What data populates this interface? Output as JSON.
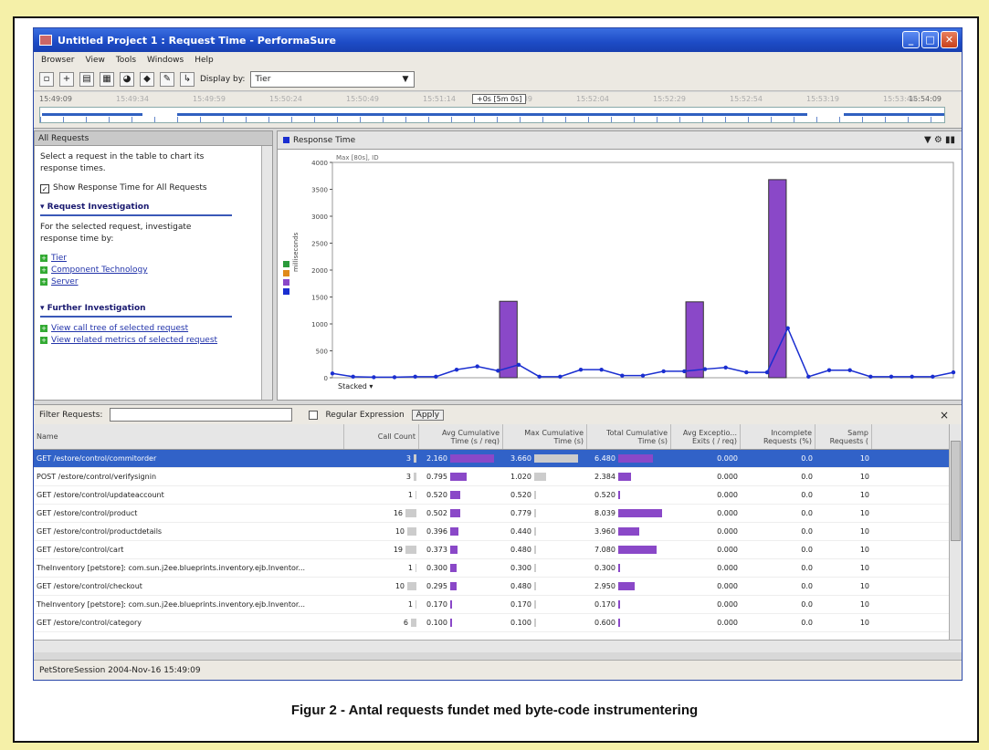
{
  "window": {
    "title": "Untitled Project 1 : Request Time - PerformaSure"
  },
  "menu": [
    "Browser",
    "View",
    "Tools",
    "Windows",
    "Help"
  ],
  "toolbar": {
    "display_by_label": "Display by:",
    "display_by_value": "Tier"
  },
  "timeline": {
    "start": "15:49:09",
    "end": "15:54:09",
    "window_label": "+0s [5m 0s]",
    "mid_ticks": [
      "15:49:34",
      "15:49:59",
      "15:50:24",
      "15:50:49",
      "15:51:14",
      "15:51:39",
      "15:52:04",
      "15:52:29",
      "15:52:54",
      "15:53:19",
      "15:53:44"
    ]
  },
  "left_panel": {
    "header": "All Requests",
    "intro": "Select a request in the table to chart its response times.",
    "checkbox_label": "Show Response Time for All Requests",
    "section1": "Request Investigation",
    "section1_text": "For the selected request, investigate response time by:",
    "links1": [
      "Tier",
      "Component Technology",
      "Server"
    ],
    "section2": "Further Investigation",
    "links2": [
      "View call tree of selected request",
      "View related metrics of selected request"
    ]
  },
  "chart_panel": {
    "header": "Response Time",
    "stacked_label": "Stacked",
    "ylabel": "milliseconds",
    "legend_top": "Max [80s], ID"
  },
  "chart_data": {
    "type": "bar",
    "ylim": [
      0,
      4000
    ],
    "yticks": [
      0,
      500,
      1000,
      1500,
      2000,
      2500,
      3000,
      3500,
      4000
    ],
    "bars": [
      {
        "x": 8.5,
        "value": 1420
      },
      {
        "x": 17.5,
        "value": 1410
      },
      {
        "x": 21.5,
        "value": 3680
      }
    ],
    "line_values": [
      80,
      20,
      10,
      10,
      20,
      20,
      150,
      210,
      130,
      240,
      20,
      20,
      150,
      150,
      40,
      40,
      120,
      120,
      160,
      190,
      100,
      100,
      920,
      20,
      140,
      140,
      20,
      20,
      20,
      20,
      100
    ]
  },
  "filter": {
    "label": "Filter Requests:",
    "regex_label": "Regular Expression",
    "apply_label": "Apply",
    "close": "×"
  },
  "table": {
    "columns": [
      "Name",
      "Call Count",
      "Avg Cumulative Time (s / req)",
      "Max Cumulative Time (s)",
      "Total Cumulative Time (s)",
      "Avg Exceptio... Exits ( / req)",
      "Incomplete Requests (%)",
      "Samp Requests ("
    ],
    "rows": [
      {
        "name": "GET /estore/control/commitorder",
        "count": "3",
        "avg": "2.160",
        "avg_frac": 1.0,
        "max": "3.660",
        "max_frac": 1.0,
        "total": "6.480",
        "total_frac": 0.8,
        "exc": "0.000",
        "inc": "0.0",
        "samp": "10"
      },
      {
        "name": "POST /estore/control/verifysignin",
        "count": "3",
        "avg": "0.795",
        "avg_frac": 0.37,
        "max": "1.020",
        "max_frac": 0.28,
        "total": "2.384",
        "total_frac": 0.3,
        "exc": "0.000",
        "inc": "0.0",
        "samp": "10"
      },
      {
        "name": "GET /estore/control/updateaccount",
        "count": "1",
        "avg": "0.520",
        "avg_frac": 0.24,
        "max": "0.520",
        "max_frac": 0.0,
        "total": "0.520",
        "total_frac": 0.0,
        "exc": "0.000",
        "inc": "0.0",
        "samp": "10"
      },
      {
        "name": "GET /estore/control/product",
        "count": "16",
        "avg": "0.502",
        "avg_frac": 0.23,
        "max": "0.779",
        "max_frac": 0.05,
        "total": "8.039",
        "total_frac": 1.0,
        "exc": "0.000",
        "inc": "0.0",
        "samp": "10"
      },
      {
        "name": "GET /estore/control/productdetails",
        "count": "10",
        "avg": "0.396",
        "avg_frac": 0.18,
        "max": "0.440",
        "max_frac": 0.0,
        "total": "3.960",
        "total_frac": 0.49,
        "exc": "0.000",
        "inc": "0.0",
        "samp": "10"
      },
      {
        "name": "GET /estore/control/cart",
        "count": "19",
        "avg": "0.373",
        "avg_frac": 0.17,
        "max": "0.480",
        "max_frac": 0.0,
        "total": "7.080",
        "total_frac": 0.88,
        "exc": "0.000",
        "inc": "0.0",
        "samp": "10"
      },
      {
        "name": "TheInventory [petstore]: com.sun.j2ee.blueprints.inventory.ejb.Inventor...",
        "count": "1",
        "avg": "0.300",
        "avg_frac": 0.14,
        "max": "0.300",
        "max_frac": 0.0,
        "total": "0.300",
        "total_frac": 0.0,
        "exc": "0.000",
        "inc": "0.0",
        "samp": "10"
      },
      {
        "name": "GET /estore/control/checkout",
        "count": "10",
        "avg": "0.295",
        "avg_frac": 0.14,
        "max": "0.480",
        "max_frac": 0.0,
        "total": "2.950",
        "total_frac": 0.37,
        "exc": "0.000",
        "inc": "0.0",
        "samp": "10"
      },
      {
        "name": "TheInventory [petstore]: com.sun.j2ee.blueprints.inventory.ejb.Inventor...",
        "count": "1",
        "avg": "0.170",
        "avg_frac": 0.0,
        "max": "0.170",
        "max_frac": 0.0,
        "total": "0.170",
        "total_frac": 0.0,
        "exc": "0.000",
        "inc": "0.0",
        "samp": "10"
      },
      {
        "name": "GET /estore/control/category",
        "count": "6",
        "avg": "0.100",
        "avg_frac": 0.0,
        "max": "0.100",
        "max_frac": 0.0,
        "total": "0.600",
        "total_frac": 0.0,
        "exc": "0.000",
        "inc": "0.0",
        "samp": "10"
      }
    ]
  },
  "status": {
    "session": "PetStoreSession 2004-Nov-16 15:49:09"
  },
  "caption": "Figur 2 - Antal requests fundet med byte-code instrumentering",
  "colors": {
    "bar": "#8a48c8",
    "line": "#1a2ed0",
    "selected": "#3162c8"
  }
}
